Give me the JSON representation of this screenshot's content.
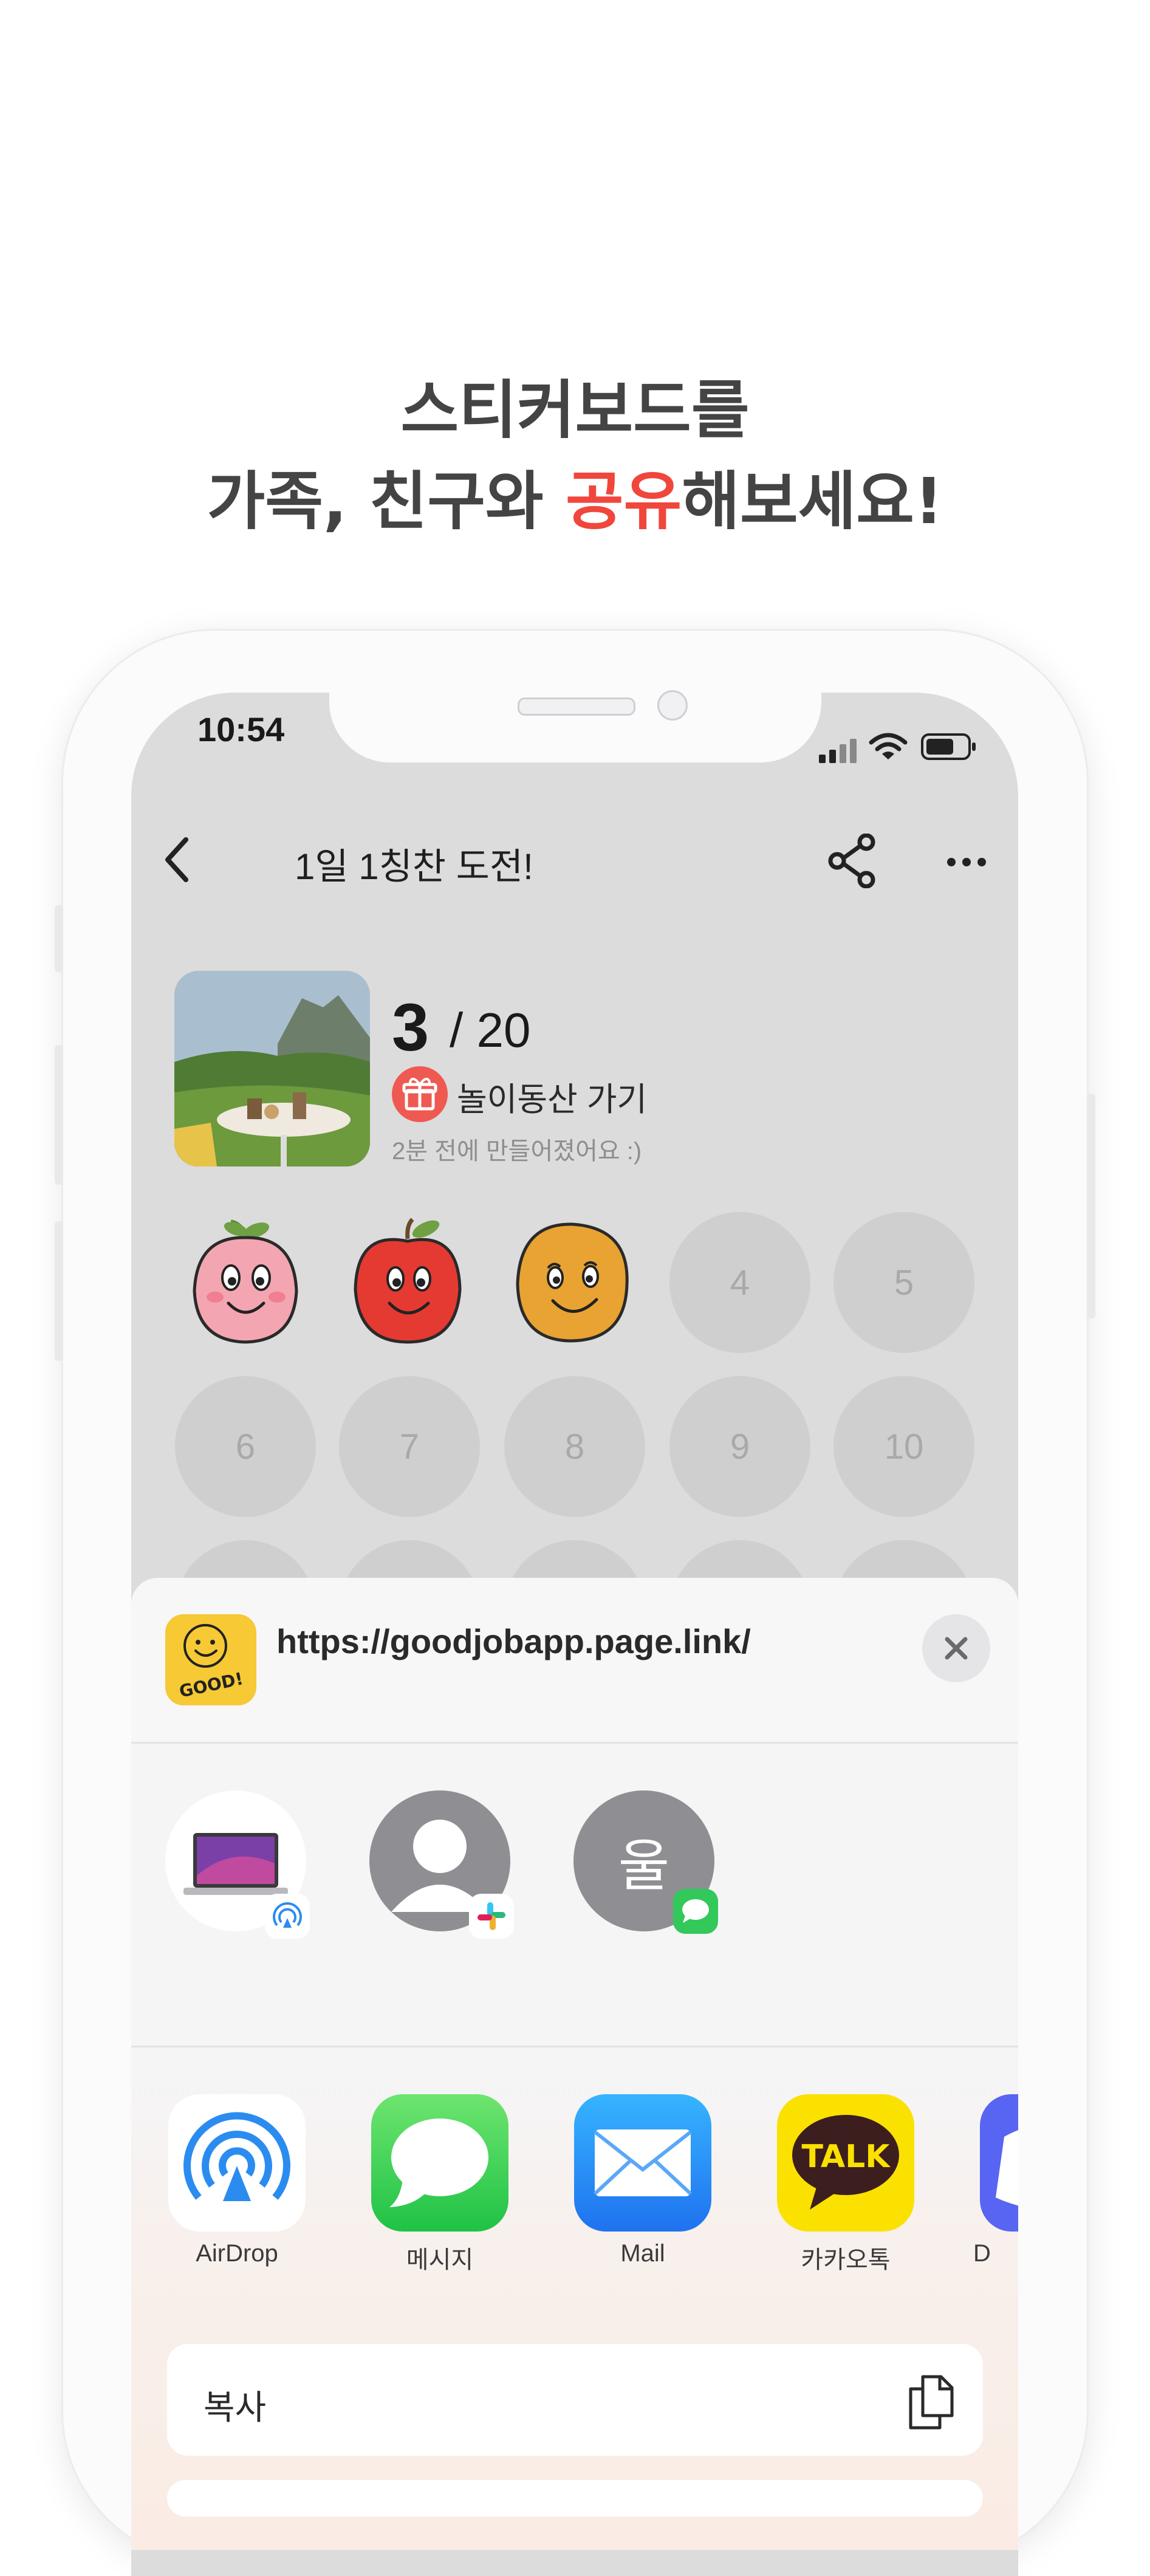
{
  "headline": {
    "line1": "스티커보드를",
    "line2_pre": "가족, 친구와 ",
    "line2_highlight": "공유",
    "line2_post": "해보세요!"
  },
  "colors": {
    "highlight": "#f0463c",
    "screen_bg": "#dcdcdc",
    "sheet_bg": "#f5f5f6"
  },
  "status_bar": {
    "time": "10:54",
    "icons": [
      "signal-icon",
      "wifi-icon",
      "battery-icon"
    ]
  },
  "nav": {
    "back_icon": "chevron-left-icon",
    "title": "1일 1칭찬 도전!",
    "share_icon": "share-icon",
    "more_icon": "more-icon"
  },
  "board": {
    "count": "3",
    "total": "/ 20",
    "reward": "놀이동산 가기",
    "created": "2분 전에 만들어졌어요 :)",
    "stickers": [
      "pink-peach-sticker",
      "red-apple-sticker",
      "orange-smiley-sticker"
    ],
    "slots": [
      "4",
      "5",
      "6",
      "7",
      "8",
      "9",
      "10"
    ]
  },
  "share_sheet": {
    "url": "https://goodjobapp.page.link/",
    "logo_text": "GOOD!",
    "contacts": [
      {
        "name": "macbook-contact",
        "badge": "airdrop-badge-icon"
      },
      {
        "name": "person-contact",
        "badge": "slack-badge-icon"
      },
      {
        "name": "ul-contact",
        "initial": "울",
        "badge": "messages-badge-icon"
      }
    ],
    "apps": [
      {
        "label": "AirDrop",
        "icon": "airdrop-icon"
      },
      {
        "label": "메시지",
        "icon": "messages-icon"
      },
      {
        "label": "Mail",
        "icon": "mail-icon"
      },
      {
        "label": "카카오톡",
        "icon": "kakaotalk-icon",
        "icon_text": "TALK"
      },
      {
        "label": "D",
        "icon": "discord-icon"
      }
    ],
    "actions": [
      {
        "label": "복사",
        "icon": "copy-icon"
      }
    ]
  }
}
